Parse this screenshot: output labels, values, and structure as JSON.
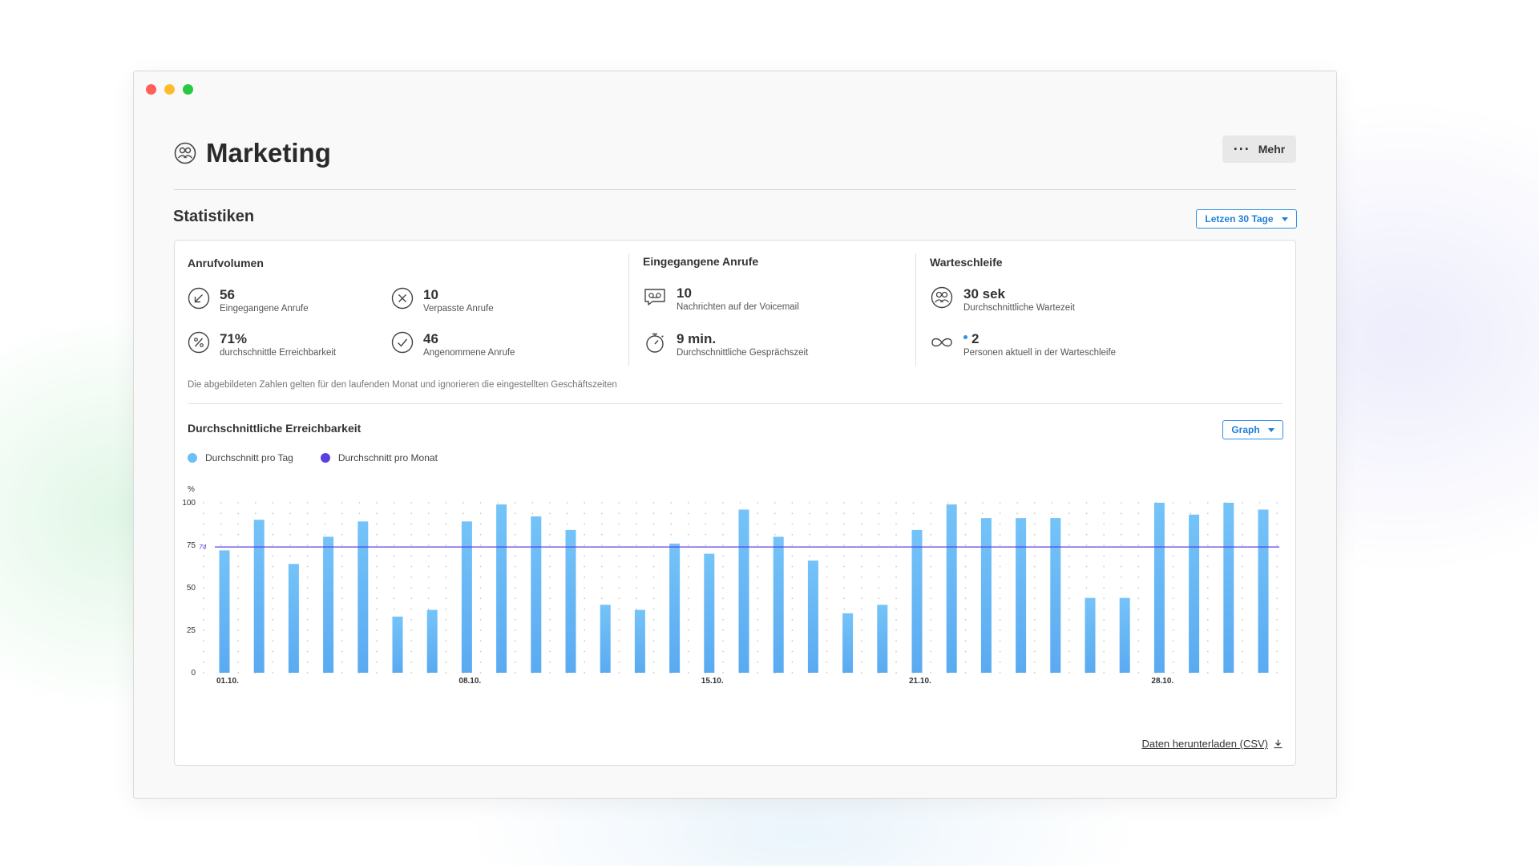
{
  "window": {
    "controls": [
      "close",
      "minimize",
      "zoom"
    ]
  },
  "header": {
    "title": "Marketing",
    "more_label": "Mehr",
    "icon": "team-icon"
  },
  "stats": {
    "title": "Statistiken",
    "range_label": "Letzen 30 Tage",
    "volume": {
      "title": "Anrufvolumen",
      "items": [
        {
          "value": "56",
          "label": "Eingegangene Anrufe",
          "icon": "incoming-call-icon"
        },
        {
          "value": "10",
          "label": "Verpasste Anrufe",
          "icon": "missed-call-icon"
        },
        {
          "value": "71%",
          "label": "durchschnittle Erreichbarkeit",
          "icon": "percent-icon"
        },
        {
          "value": "46",
          "label": "Angenommene Anrufe",
          "icon": "check-icon"
        }
      ]
    },
    "incoming": {
      "title": "Eingegangene Anrufe",
      "items": [
        {
          "value": "10",
          "label": "Nachrichten auf der Voicemail",
          "icon": "voicemail-icon"
        },
        {
          "value": "9 min.",
          "label": "Durchschnittliche Gesprächszeit",
          "icon": "stopwatch-icon"
        }
      ]
    },
    "queue": {
      "title": "Warteschleife",
      "items": [
        {
          "value": "30 sek",
          "label": "Durchschnittliche Wartezeit",
          "icon": "team-icon"
        },
        {
          "value": "2",
          "label": "Personen aktuell in der Warteschleife",
          "icon": "infinity-icon"
        }
      ]
    },
    "note": "Die abgebildeten Zahlen gelten für den laufenden Monat und ignorieren die eingestellten Geschäftszeiten"
  },
  "chart_section": {
    "title": "Durchschnittliche Erreichbarkeit",
    "view_label": "Graph",
    "download_label": "Daten herunterladen (CSV)"
  },
  "chart_data": {
    "type": "bar",
    "ylabel": "%",
    "ylim": [
      0,
      100
    ],
    "yticks": [
      0,
      25,
      50,
      75,
      100
    ],
    "grid": true,
    "legend_position": "top-left",
    "categories": [
      "01.10.",
      "02.10.",
      "03.10.",
      "04.10.",
      "05.10.",
      "06.10.",
      "07.10.",
      "08.10.",
      "09.10.",
      "10.10.",
      "11.10.",
      "12.10.",
      "13.10.",
      "14.10.",
      "15.10.",
      "16.10.",
      "17.10.",
      "18.10.",
      "19.10.",
      "20.10.",
      "21.10.",
      "22.10.",
      "23.10.",
      "24.10.",
      "25.10.",
      "26.10.",
      "27.10.",
      "28.10.",
      "29.10.",
      "30.10.",
      "31.10."
    ],
    "tick_labels": [
      "01.10.",
      "08.10.",
      "15.10.",
      "21.10.",
      "28.10."
    ],
    "series": [
      {
        "name": "Durchschnitt pro Tag",
        "type": "bar",
        "color": "#6ebef7",
        "values": [
          72,
          90,
          64,
          80,
          89,
          33,
          37,
          89,
          99,
          92,
          84,
          40,
          37,
          76,
          70,
          96,
          80,
          66,
          35,
          40,
          84,
          99,
          91,
          91,
          91,
          44,
          44,
          100,
          93,
          100,
          96
        ]
      },
      {
        "name": "Durchschnitt pro Monat",
        "type": "line",
        "color": "#5b3fe0",
        "value": 74
      }
    ],
    "average_label": "74"
  },
  "colors": {
    "accent": "#1f7fd9",
    "bar": "#6ebef7",
    "average": "#5b3fe0",
    "status_dot": "#2f8ee6"
  }
}
